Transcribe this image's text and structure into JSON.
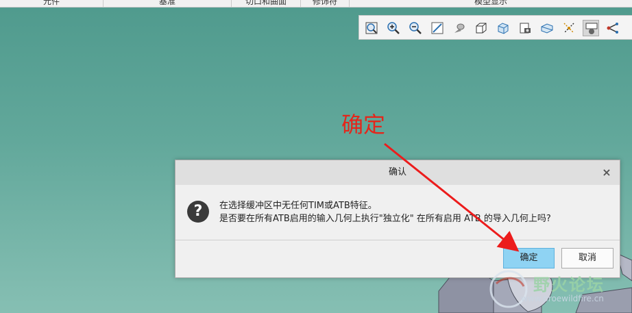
{
  "ribbon": {
    "groups": [
      "元件",
      "基准",
      "切口和曲面",
      "修饰符",
      "模型显示"
    ]
  },
  "graphics_toolbar": {
    "icons": [
      "refit-icon",
      "zoom-in-icon",
      "zoom-out-icon",
      "repaint-icon",
      "perspective-view-icon",
      "display-style-icon",
      "saved-orientations-icon",
      "view-manager-icon",
      "section-icon",
      "datum-display-icon",
      "annotation-display-icon",
      "spin-center-icon"
    ]
  },
  "annotation": {
    "label": "确定",
    "color": "#e4261b"
  },
  "dialog": {
    "title": "确认",
    "close": "×",
    "icon": "question-icon",
    "line1": "在选择缓冲区中无任何TIM或ATB特征。",
    "line2": "是否要在所有ATB启用的输入几何上执行\"独立化\" 在所有启用 ATB 的导入几何上吗?",
    "ok_label": "确定",
    "cancel_label": "取消"
  },
  "watermark": {
    "name": "野火论坛",
    "url": "www.proewildfire.cn"
  }
}
